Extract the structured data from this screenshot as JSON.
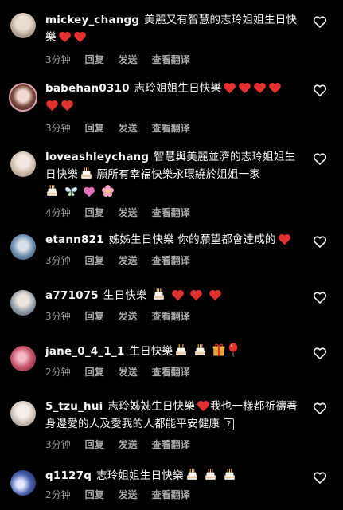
{
  "comments": [
    {
      "user": "mickey_changg",
      "text": "美麗又有智慧的志玲姐姐生日快樂",
      "time": "3分钟",
      "reply": "回复",
      "send": "发送",
      "translate": "查看翻译"
    },
    {
      "user": "babehan0310",
      "text": "志玲姐姐生日快樂",
      "time": "3分钟",
      "reply": "回复",
      "send": "发送",
      "translate": "查看翻译"
    },
    {
      "user": "loveashleychang",
      "text": "智慧與美麗並濟的志玲姐姐生日快樂",
      "text2": "願所有幸福快樂永環繞於姐姐一家",
      "time": "4分钟",
      "reply": "回复",
      "send": "发送",
      "translate": "查看翻译"
    },
    {
      "user": "etann821",
      "text": "姊姊生日快樂 你的願望都會達成的",
      "time": "3分钟",
      "reply": "回复",
      "send": "发送",
      "translate": "查看翻译"
    },
    {
      "user": "a771075",
      "text": "生日快樂",
      "time": "3分钟",
      "reply": "回复",
      "send": "发送",
      "translate": "查看翻译"
    },
    {
      "user": "jane_0_4_1_1",
      "text": "生日快樂",
      "time": "2分钟",
      "reply": "回复",
      "send": "发送",
      "translate": "查看翻译"
    },
    {
      "user": "5_tzu_hui",
      "text": "志玲姊姊生日快樂",
      "text2": "我也一樣都祈禱著身邊愛的人及愛我的人都能平安健康",
      "text3": "?",
      "time": "3分钟",
      "reply": "回复",
      "send": "发送",
      "translate": "查看翻译"
    },
    {
      "user": "q1127q",
      "text": "志玲姐姐生日快樂",
      "time": "2分钟",
      "reply": "回复",
      "send": "发送",
      "translate": "查看翻译"
    }
  ],
  "colors": {
    "background": "#000000",
    "text": "#f5f5f5",
    "meta": "#9a9a9a",
    "heart_red": "#e0302f"
  },
  "icons": {
    "like": "heart-outline-icon",
    "heart": "red-heart-emoji",
    "cake": "birthday-cake-emoji"
  }
}
